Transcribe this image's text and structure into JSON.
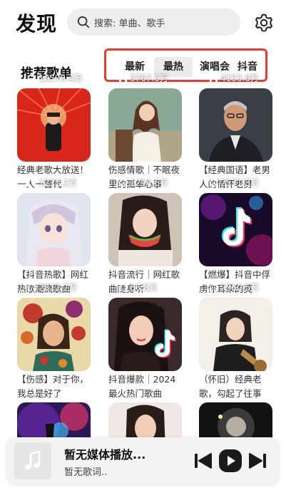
{
  "header": {
    "title": "发现",
    "search_placeholder": "搜索: 单曲、歌手"
  },
  "section": {
    "title": "推荐歌单",
    "tabs": [
      {
        "label": "最新",
        "active": false
      },
      {
        "label": "最热",
        "active": true
      },
      {
        "label": "演唱会",
        "active": false
      },
      {
        "label": "抖音",
        "active": false
      }
    ]
  },
  "playlists": [
    {
      "plays": "10579.4万",
      "title": "经典老歌大放送！一人一首代",
      "cover": "red-stage"
    },
    {
      "plays": "3767.5万",
      "title": "伤感情歌｜不眠夜里的孤单心事",
      "cover": "illustration-girl"
    },
    {
      "plays": "4153.8万",
      "title": "【经典国语】老男人的情怀老男",
      "cover": "man-portrait"
    },
    {
      "plays": "1231.2万",
      "title": "【抖音热歌】网红热歌潮流歌曲",
      "cover": "anime-girl"
    },
    {
      "plays": "1294.6万",
      "title": "抖音流行｜网红歌曲随身听",
      "cover": "watermelon-girl"
    },
    {
      "plays": "2571.3万",
      "title": "【燃爆】抖音中俘虏你耳朵的英",
      "cover": "tiktok-logo"
    },
    {
      "plays": "2812.7万",
      "title": "【伤感】对于你，我总是好了",
      "cover": "flower-art"
    },
    {
      "plays": "66.8万",
      "title": "抖音爆款｜2024最火热门歌曲",
      "cover": "tiktok-girl"
    },
    {
      "plays": "2360.5万",
      "title": "（怀旧）经典老歌，勾起了往事",
      "cover": "woman-guitar"
    },
    {
      "plays": "",
      "title": "",
      "cover": "concert"
    },
    {
      "plays": "",
      "title": "",
      "cover": "woman-portrait"
    },
    {
      "plays": "",
      "title": "",
      "cover": "night-scene"
    }
  ],
  "player": {
    "title": "暂无媒体播放...",
    "lyric": "暂无歌词.."
  },
  "colors": {
    "highlight_border": "#e83c2e",
    "active_tab_bg": "#ebebeb",
    "search_bg": "#eeeeee"
  }
}
